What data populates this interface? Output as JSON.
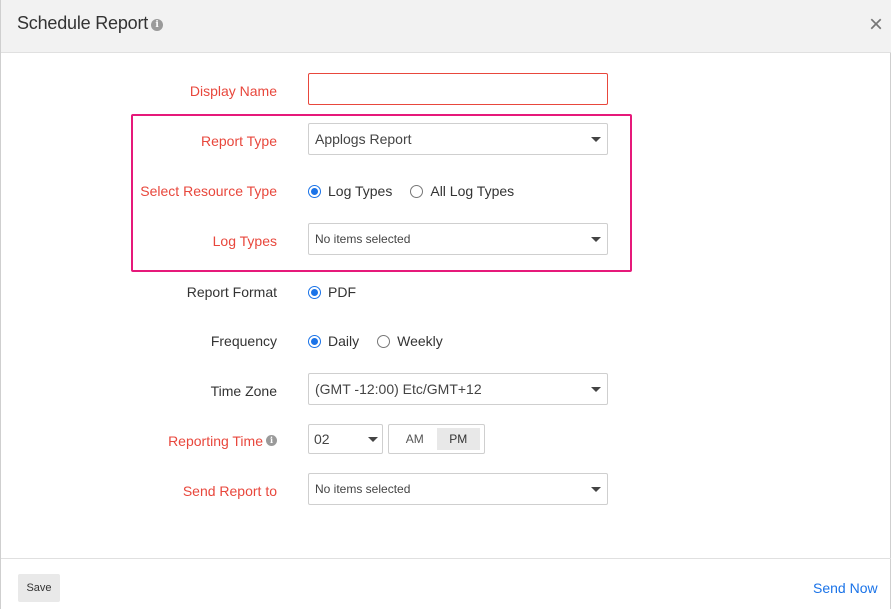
{
  "dialog": {
    "title": "Schedule Report",
    "close_symbol": "×"
  },
  "icons": {
    "info": "info-icon",
    "close": "close-icon",
    "dropdown": "chevron-down-icon"
  },
  "colors": {
    "required_label": "#e8473c",
    "highlight_border": "#e6197a",
    "accent": "#1a73e8"
  },
  "form": {
    "display_name": {
      "label": "Display Name",
      "value": ""
    },
    "report_type": {
      "label": "Report Type",
      "value": "Applogs Report"
    },
    "resource_type": {
      "label": "Select Resource Type",
      "options": [
        "Log Types",
        "All Log Types"
      ],
      "selected": "Log Types"
    },
    "log_types": {
      "label": "Log Types",
      "value": "No items selected"
    },
    "report_format": {
      "label": "Report Format",
      "options": [
        "PDF"
      ],
      "selected": "PDF"
    },
    "frequency": {
      "label": "Frequency",
      "options": [
        "Daily",
        "Weekly"
      ],
      "selected": "Daily"
    },
    "time_zone": {
      "label": "Time Zone",
      "value": "(GMT -12:00) Etc/GMT+12"
    },
    "reporting_time": {
      "label": "Reporting Time",
      "hour": "02",
      "am": "AM",
      "pm": "PM",
      "selected": "PM"
    },
    "send_report_to": {
      "label": "Send Report to",
      "value": "No items selected"
    }
  },
  "footer": {
    "save_label": "Save",
    "send_now_label": "Send Now"
  }
}
